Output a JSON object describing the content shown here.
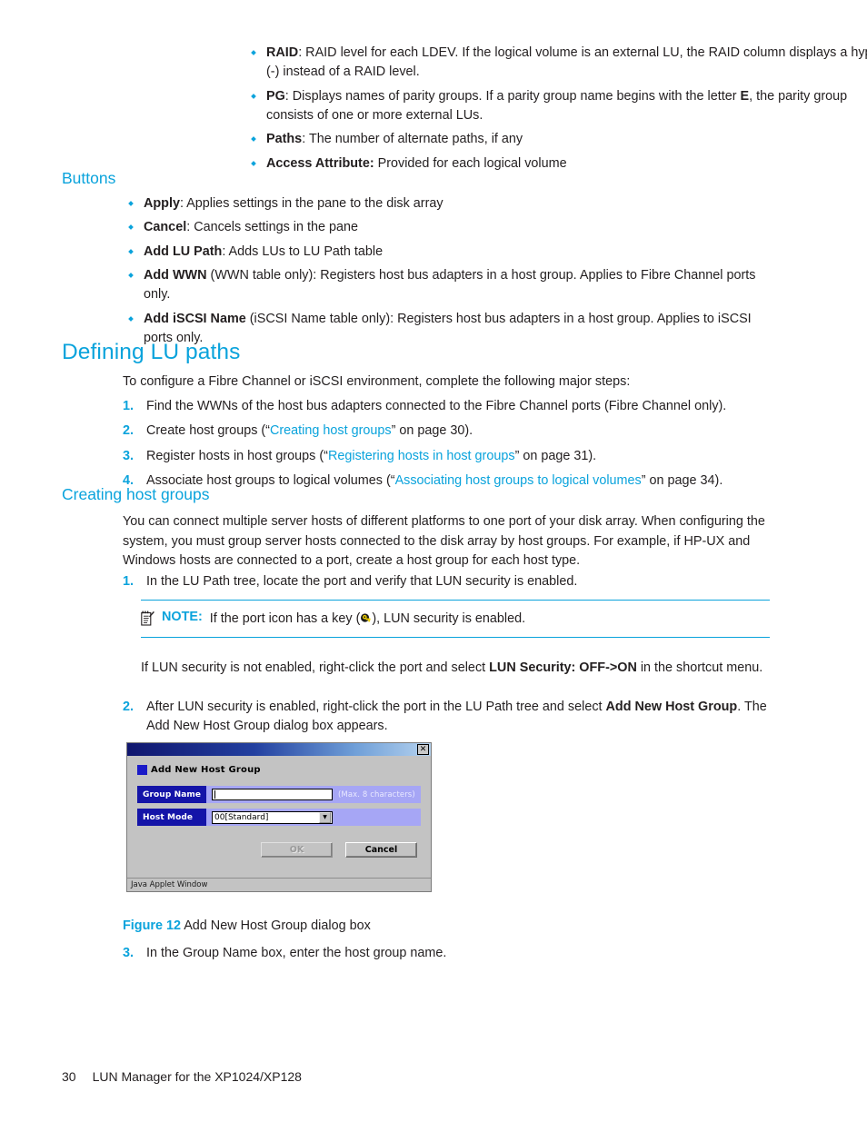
{
  "page": {
    "number": "30",
    "footer_title": "LUN Manager for the XP1024/XP128"
  },
  "colors": {
    "accent": "#0aa3dc",
    "body_text": "#231f20",
    "dialog_face": "#c3c3c3",
    "dialog_label": "#1414a8",
    "dialog_field": "#a6a6f5"
  },
  "top_bullets": [
    {
      "term": "RAID",
      "rest": ": RAID level for each LDEV. If the logical volume is an external LU, the RAID column displays a hyphen (-) instead of a RAID level."
    },
    {
      "term": "PG",
      "rest_a": ": Displays names of parity groups. If a parity group name begins with the letter ",
      "emphasis": "E",
      "rest_b": ", the parity group consists of one or more external LUs."
    },
    {
      "term": "Paths",
      "rest": ": The number of alternate paths, if any"
    },
    {
      "term": "Access Attribute:",
      "rest": " Provided for each logical volume"
    }
  ],
  "buttons_section": {
    "heading": "Buttons",
    "items": [
      {
        "term": "Apply",
        "rest": ": Applies settings in the pane to the disk array"
      },
      {
        "term": "Cancel",
        "rest": ": Cancels settings in the pane"
      },
      {
        "term": "Add LU Path",
        "rest": ": Adds LUs to LU Path table"
      },
      {
        "term": "Add WWN",
        "rest": " (WWN table only): Registers host bus adapters in a host group. Applies to Fibre Channel ports only."
      },
      {
        "term": "Add iSCSI Name",
        "rest": " (iSCSI Name table only): Registers host bus adapters in a host group. Applies to iSCSI ports only."
      }
    ]
  },
  "defining_section": {
    "heading": "Defining LU paths",
    "intro": "To configure a Fibre Channel or iSCSI environment, complete the following major steps:",
    "steps": [
      {
        "text": "Find the WWNs of the host bus adapters connected to the Fibre Channel ports (Fibre Channel only)."
      },
      {
        "pre": "Create host groups (“",
        "link": "Creating host groups",
        "post": "” on page 30)."
      },
      {
        "pre": "Register hosts in host groups (“",
        "link": "Registering hosts in host groups",
        "post": "” on page 31)."
      },
      {
        "pre": "Associate host groups to logical volumes (“",
        "link": "Associating host groups to logical volumes",
        "post": "” on page 34)."
      }
    ]
  },
  "creating_section": {
    "heading": "Creating host groups",
    "paragraph": "You can connect multiple server hosts of different platforms to one port of your disk array. When configuring the system, you must group server hosts connected to the disk array by host groups. For example, if HP-UX and Windows hosts are connected to a port, create a host group for each host type.",
    "step1": "In the LU Path tree, locate the port and verify that LUN security is enabled.",
    "note": {
      "label": "NOTE:",
      "text_a": "If the port icon has a key (",
      "text_b": "), LUN security is enabled."
    },
    "after_note_a": "If LUN security is not enabled, right-click the port and select ",
    "after_note_bold": "LUN Security: OFF->ON",
    "after_note_b": " in the shortcut menu.",
    "step2_a": "After LUN security is enabled, right-click the port in the LU Path tree and select ",
    "step2_bold": "Add New Host Group",
    "step2_b": ". The Add New Host Group dialog box appears.",
    "step3": "In the Group Name box, enter the host group name."
  },
  "figure": {
    "number": "Figure 12",
    "caption": "Add New Host Group dialog box"
  },
  "dialog": {
    "close_label": "✕",
    "heading": "Add New Host Group",
    "group_name_label": "Group Name",
    "group_name_value": "",
    "group_name_hint": "(Max. 8 characters)",
    "host_mode_label": "Host Mode",
    "host_mode_value": "00[Standard]",
    "host_mode_options": [
      "00[Standard]"
    ],
    "combo_arrow": "▼",
    "ok_label": "OK",
    "cancel_label": "Cancel",
    "statusbar": "Java Applet Window"
  }
}
